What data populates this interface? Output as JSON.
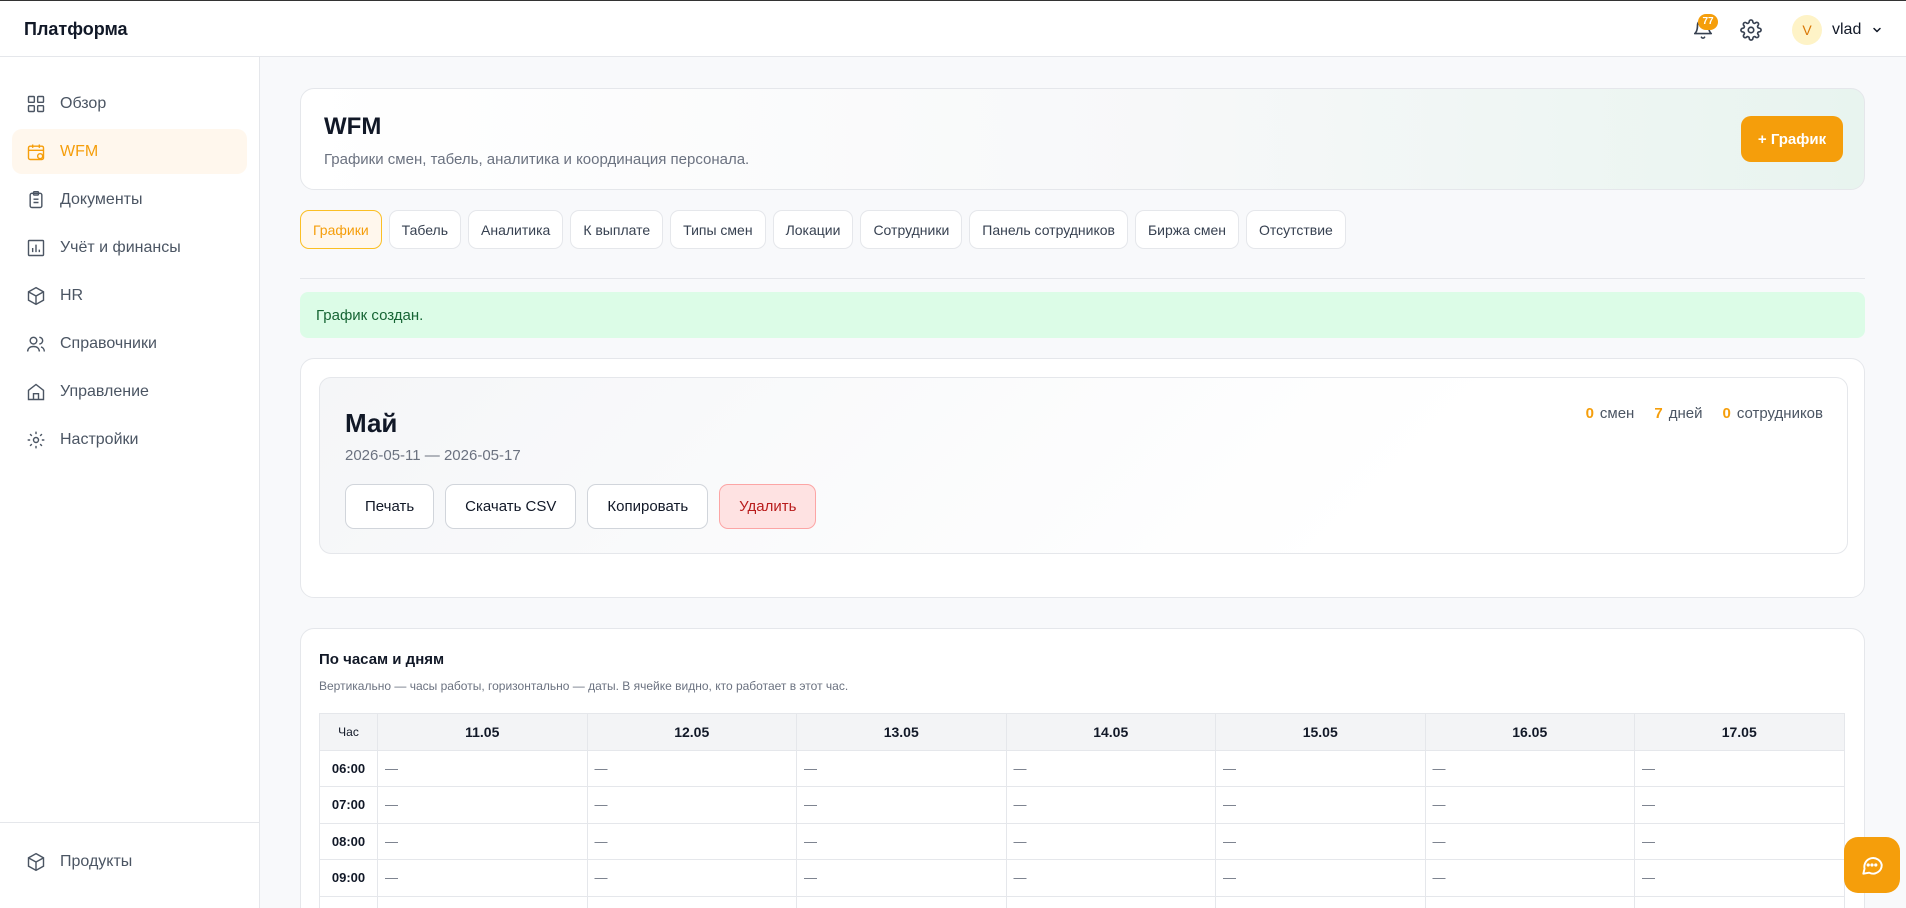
{
  "brand": "Платформа",
  "topbar": {
    "notifications_count": "77",
    "user_initial": "V",
    "user_name": "vlad"
  },
  "sidebar": {
    "items": [
      {
        "label": "Обзор",
        "icon": "grid-icon"
      },
      {
        "label": "WFM",
        "icon": "calendar-icon",
        "active": true
      },
      {
        "label": "Документы",
        "icon": "clipboard-icon"
      },
      {
        "label": "Учёт и финансы",
        "icon": "bar-chart-icon"
      },
      {
        "label": "HR",
        "icon": "cube-icon"
      },
      {
        "label": "Справочники",
        "icon": "users-icon"
      },
      {
        "label": "Управление",
        "icon": "building-icon"
      },
      {
        "label": "Настройки",
        "icon": "gear-icon"
      }
    ],
    "bottom_item": {
      "label": "Продукты",
      "icon": "box-icon"
    }
  },
  "header": {
    "title": "WFM",
    "subtitle": "Графики смен, табель, аналитика и координация персонала.",
    "primary_button": "+ График"
  },
  "tabs": [
    "Графики",
    "Табель",
    "Аналитика",
    "К выплате",
    "Типы смен",
    "Локации",
    "Сотрудники",
    "Панель сотрудников",
    "Биржа смен",
    "Отсутствие"
  ],
  "active_tab": "Графики",
  "alert": "График создан.",
  "schedule": {
    "title": "Май",
    "date_range": "2026-05-11 — 2026-05-17",
    "stats": [
      {
        "value": "0",
        "label": "смен"
      },
      {
        "value": "7",
        "label": "дней"
      },
      {
        "value": "0",
        "label": "сотрудников"
      }
    ],
    "actions": {
      "print": "Печать",
      "download_csv": "Скачать CSV",
      "copy": "Копировать",
      "delete": "Удалить"
    }
  },
  "hours": {
    "title": "По часам и дням",
    "subtitle": "Вертикально — часы работы, горизонтально — даты. В ячейке видно, кто работает в этот час.",
    "hour_header": "Час",
    "days": [
      "11.05",
      "12.05",
      "13.05",
      "14.05",
      "15.05",
      "16.05",
      "17.05"
    ],
    "rows": [
      {
        "hour": "06:00",
        "cells": [
          "—",
          "—",
          "—",
          "—",
          "—",
          "—",
          "—"
        ]
      },
      {
        "hour": "07:00",
        "cells": [
          "—",
          "—",
          "—",
          "—",
          "—",
          "—",
          "—"
        ]
      },
      {
        "hour": "08:00",
        "cells": [
          "—",
          "—",
          "—",
          "—",
          "—",
          "—",
          "—"
        ]
      },
      {
        "hour": "09:00",
        "cells": [
          "—",
          "—",
          "—",
          "—",
          "—",
          "—",
          "—"
        ]
      },
      {
        "hour": "",
        "cells": [
          "",
          "",
          "",
          "",
          "",
          "",
          ""
        ]
      }
    ]
  },
  "colors": {
    "accent": "#f59e0b",
    "success_bg": "#dcfce7",
    "danger": "#b91c1c"
  }
}
